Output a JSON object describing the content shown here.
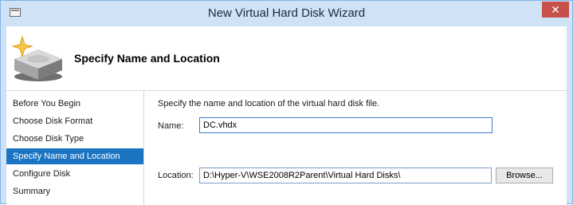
{
  "window": {
    "title": "New Virtual Hard Disk Wizard",
    "close_glyph": "✕",
    "icons": {
      "system": "window-icon",
      "close": "close-icon"
    }
  },
  "header": {
    "title": "Specify Name and Location",
    "icon": "hard-disk-sparkle-icon"
  },
  "nav": {
    "items": [
      {
        "label": "Before You Begin"
      },
      {
        "label": "Choose Disk Format"
      },
      {
        "label": "Choose Disk Type"
      },
      {
        "label": "Specify Name and Location",
        "selected": true
      },
      {
        "label": "Configure Disk"
      },
      {
        "label": "Summary"
      }
    ]
  },
  "content": {
    "description": "Specify the name and location of the virtual hard disk file.",
    "name_label": "Name:",
    "name_value": "DC.vhdx",
    "location_label": "Location:",
    "location_value": "D:\\Hyper-V\\WSE2008R2Parent\\Virtual Hard Disks\\",
    "browse_label": "Browse..."
  },
  "colors": {
    "titlebar": "#cfe2f6",
    "selection": "#1d74c2",
    "close": "#c7504a"
  }
}
